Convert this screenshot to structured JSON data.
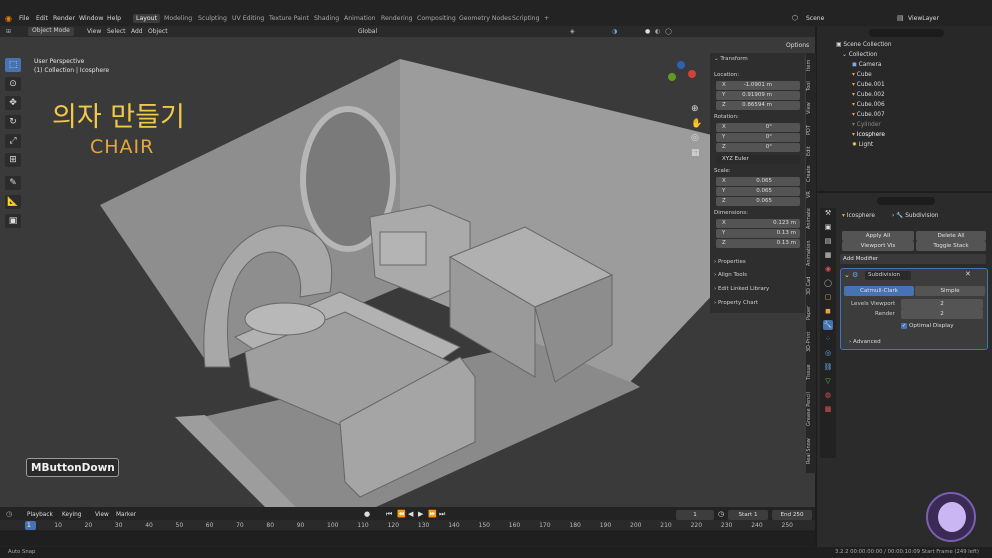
{
  "menus": [
    "File",
    "Edit",
    "Render",
    "Window",
    "Help"
  ],
  "workspaces": [
    "Layout",
    "Modeling",
    "Sculpting",
    "UV Editing",
    "Texture Paint",
    "Shading",
    "Animation",
    "Rendering",
    "Compositing",
    "Geometry Nodes",
    "Scripting"
  ],
  "add_tab": "+",
  "scene_name": "Scene",
  "view_layer": "ViewLayer",
  "viewport_header": {
    "mode": "Object Mode",
    "view": "View",
    "select": "Select",
    "add": "Add",
    "object": "Object",
    "transform": "Global",
    "options": "Options"
  },
  "viewport": {
    "perspective": "User Perspective",
    "context": "(1) Collection | Icosphere",
    "title_korean": "의자 만들기",
    "title_english": "CHAIR",
    "overlay_key": "MButtonDown"
  },
  "transform": {
    "header": "Transform",
    "location_label": "Location:",
    "location": [
      {
        "k": "X",
        "v": "-1.0901 m"
      },
      {
        "k": "Y",
        "v": "0.91909 m"
      },
      {
        "k": "Z",
        "v": "0.86594 m"
      }
    ],
    "rotation_label": "Rotation:",
    "rotation": [
      {
        "k": "X",
        "v": "0°"
      },
      {
        "k": "Y",
        "v": "0°"
      },
      {
        "k": "Z",
        "v": "0°"
      }
    ],
    "rotation_mode": "XYZ Euler",
    "scale_label": "Scale:",
    "scale": [
      {
        "k": "X",
        "v": "0.065"
      },
      {
        "k": "Y",
        "v": "0.065"
      },
      {
        "k": "Z",
        "v": "0.065"
      }
    ],
    "dimensions_label": "Dimensions:",
    "dimensions": [
      {
        "k": "X",
        "v": "0.123 m"
      },
      {
        "k": "Y",
        "v": "0.13 m"
      },
      {
        "k": "Z",
        "v": "0.13 m"
      }
    ],
    "sections": [
      "Properties",
      "Align Tools",
      "Edit Linked Library",
      "Property Chart"
    ]
  },
  "side_tabs": [
    "Item",
    "Tool",
    "View",
    "PDT",
    "Edit",
    "Create",
    "VR",
    "Animate",
    "Animation",
    "3D Cad",
    "Paper",
    "3D-Print",
    "Tissue",
    "Grease Pencil",
    "Real Snow"
  ],
  "outliner": {
    "root": "Scene Collection",
    "collection": "Collection",
    "items": [
      "Camera",
      "Cube",
      "Cube.001",
      "Cube.002",
      "Cube.006",
      "Cube.007",
      "Cylinder",
      "Icosphere",
      "Light"
    ]
  },
  "properties": {
    "object": "Icosphere",
    "modifier_breadcrumb": "Subdivision",
    "apply_all": "Apply All",
    "delete_all": "Delete All",
    "viewport_vis": "Viewport Vis",
    "toggle_stack": "Toggle Stack",
    "add_modifier": "Add Modifier",
    "modifier_name": "Subdivision",
    "catmull": "Catmull-Clark",
    "simple": "Simple",
    "levels_viewport_label": "Levels Viewport",
    "levels_viewport": "2",
    "render_label": "Render",
    "render": "2",
    "optimal_display": "Optimal Display",
    "advanced": "Advanced"
  },
  "timeline": {
    "playback": "Playback",
    "keying": "Keying",
    "view": "View",
    "marker": "Marker",
    "current_frame": "1",
    "start_label": "Start",
    "start": "1",
    "end_label": "End",
    "end": "250",
    "ticks": [
      "1",
      "10",
      "20",
      "30",
      "40",
      "50",
      "60",
      "70",
      "80",
      "90",
      "100",
      "110",
      "120",
      "130",
      "140",
      "150",
      "160",
      "170",
      "180",
      "190",
      "200",
      "210",
      "220",
      "230",
      "240",
      "250"
    ]
  },
  "status": {
    "left": "Auto Snap",
    "right": "3.2.2   00:00:00:00 / 00:00:10:09   Start Frame (249 left)"
  }
}
